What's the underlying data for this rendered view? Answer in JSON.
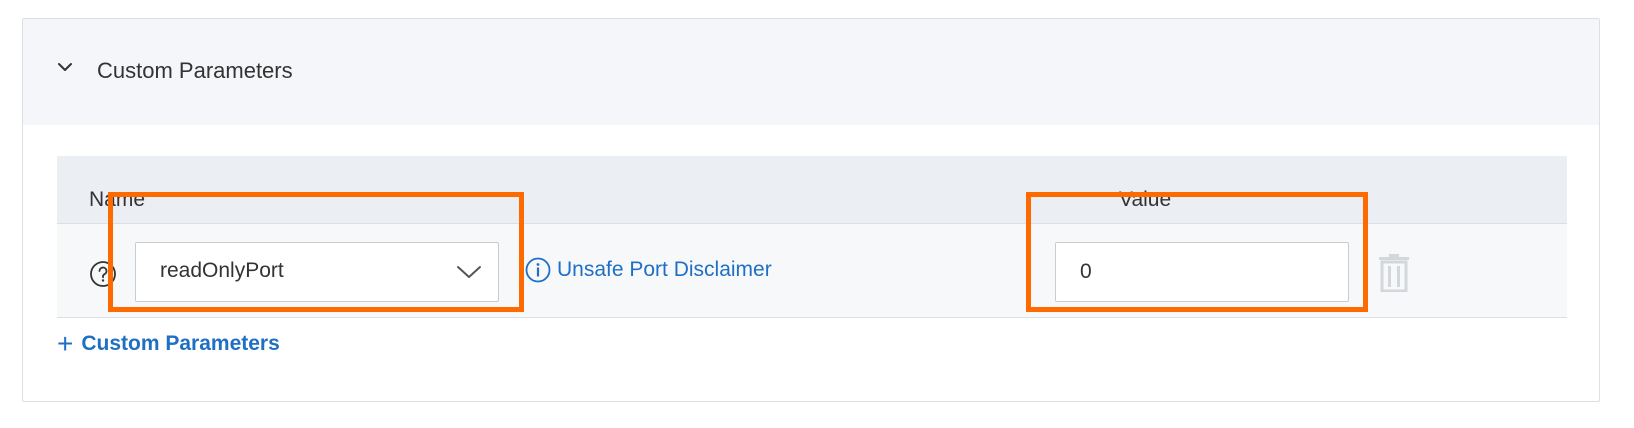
{
  "section": {
    "title": "Custom Parameters",
    "collapse_icon": "chevron-down-icon"
  },
  "table": {
    "headers": {
      "name": "Name",
      "value": "Value"
    },
    "rows": [
      {
        "help_icon": "question-circle-icon",
        "name_selected": "readOnlyPort",
        "disclaimer_icon": "info-circle-icon",
        "disclaimer_label": "Unsafe Port Disclaimer",
        "value": "0",
        "delete_icon": "trash-icon"
      }
    ]
  },
  "add_button": {
    "icon": "plus-icon",
    "label": "Custom Parameters"
  },
  "colors": {
    "accent": "#1f6fc5",
    "highlight": "#ff6a00",
    "header_bg": "#f4f6f9",
    "table_header_bg": "#ebeef3"
  }
}
